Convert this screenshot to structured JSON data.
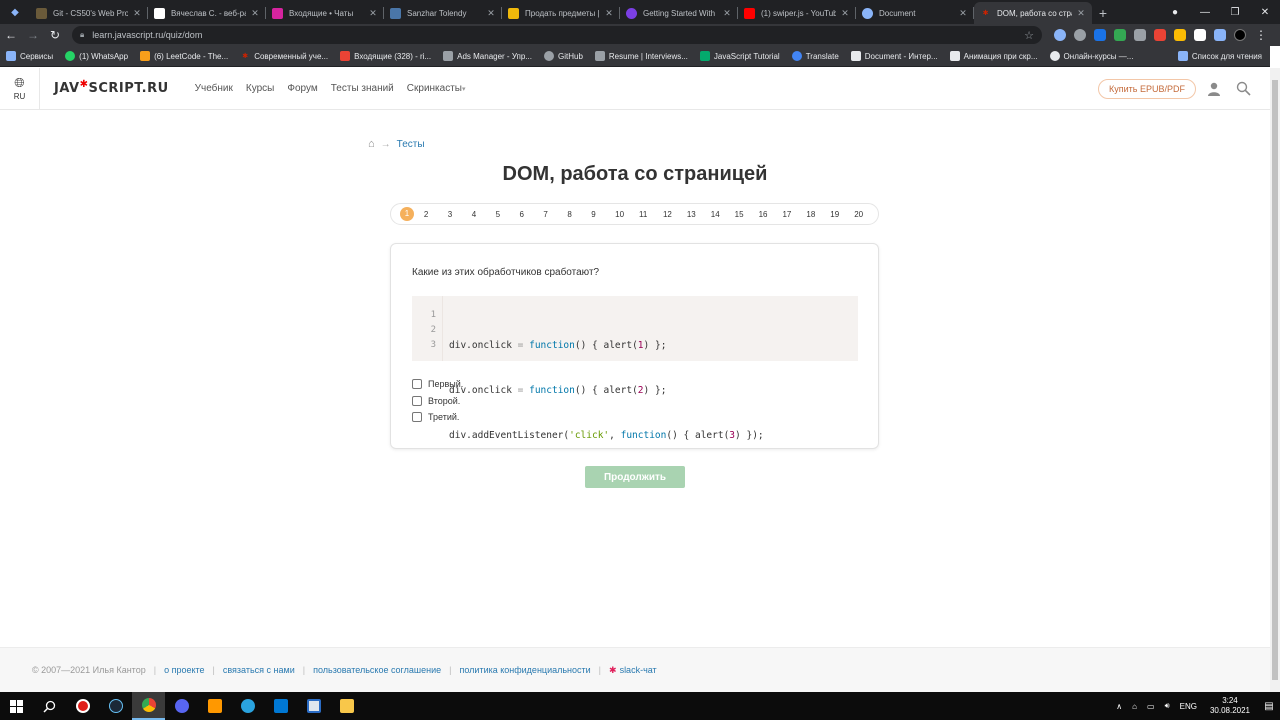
{
  "browser": {
    "tabs": [
      {
        "title": "Git - CS50's Web Prog",
        "color": "#6a5a3a"
      },
      {
        "title": "Вячеслав С. - веб-ра",
        "color": "#ffffff"
      },
      {
        "title": "Входящие • Чаты",
        "color": "#d6249f"
      },
      {
        "title": "Sanzhar Tolendy",
        "color": "#4a76a8"
      },
      {
        "title": "Продать предметы |",
        "color": "#f0b90b"
      },
      {
        "title": "Getting Started With",
        "color": "#7b3fe4"
      },
      {
        "title": "(1) swiper.js - YouTub",
        "color": "#ff0000"
      },
      {
        "title": "Document",
        "color": "#8ab4f8"
      },
      {
        "title": "DOM, работа со стра",
        "color": "#cc2200",
        "active": true
      }
    ],
    "url": "learn.javascript.ru/quiz/dom",
    "bookmarks": [
      {
        "label": "Сервисы",
        "color": "#8ab4f8"
      },
      {
        "label": "(1) WhatsApp",
        "color": "#25d366"
      },
      {
        "label": "(6) LeetCode - The...",
        "color": "#f89f1b"
      },
      {
        "label": "Современный уче...",
        "color": "#cc2200"
      },
      {
        "label": "Входящие (328) - ri...",
        "color": "#ea4335"
      },
      {
        "label": "Ads Manager - Упр...",
        "color": "#9aa0a6"
      },
      {
        "label": "GitHub",
        "color": "#9aa0a6"
      },
      {
        "label": "Resume | Interviews...",
        "color": "#9aa0a6"
      },
      {
        "label": "JavaScript Tutorial",
        "color": "#04aa6d"
      },
      {
        "label": "Translate",
        "color": "#4285f4"
      },
      {
        "label": "Document - Интер...",
        "color": "#e8eaed"
      },
      {
        "label": "Анимация при скр...",
        "color": "#e8eaed"
      },
      {
        "label": "Онлайн-курсы —...",
        "color": "#e8eaed"
      }
    ],
    "reading_list": "Список для чтения"
  },
  "header": {
    "lang_code": "RU",
    "logo_left": "JAV",
    "logo_star": "✱",
    "logo_right": "SCRIPT.RU",
    "nav": [
      "Учебник",
      "Курсы",
      "Форум",
      "Тесты знаний"
    ],
    "nav_dropdown": "Скринкасты",
    "buy_label": "Купить EPUB/PDF"
  },
  "breadcrumb": {
    "arrow": "→",
    "link": "Тесты"
  },
  "title": "DOM, работа со страницей",
  "pager": {
    "current": "1",
    "pages": [
      "2",
      "3",
      "4",
      "5",
      "6",
      "7",
      "8",
      "9",
      "10",
      "11",
      "12",
      "13",
      "14",
      "15",
      "16",
      "17",
      "18",
      "19",
      "20"
    ]
  },
  "quiz": {
    "question": "Какие из этих обработчиков сработают?",
    "line_numbers": [
      "1",
      "2",
      "3"
    ],
    "code": {
      "l1_a": "div.onclick ",
      "l1_eq": "=",
      "l1_fn": "function",
      "l1_b": "() { alert(",
      "l1_num": "1",
      "l1_c": ") };",
      "l2_a": "div.onclick ",
      "l2_eq": "=",
      "l2_fn": "function",
      "l2_b": "() { alert(",
      "l2_num": "2",
      "l2_c": ") };",
      "l3_a": "div.addEventListener(",
      "l3_str": "'click'",
      "l3_b": ", ",
      "l3_fn": "function",
      "l3_c": "() { alert(",
      "l3_num": "3",
      "l3_d": ") });"
    },
    "options": [
      "Первый.",
      "Второй.",
      "Третий."
    ],
    "continue_label": "Продолжить"
  },
  "footer": {
    "copyright": "© 2007—2021  Илья Кантор",
    "links": [
      "о проекте",
      "связаться с нами",
      "пользовательское соглашение",
      "политика конфиденциальности",
      "slack-чат"
    ]
  },
  "taskbar": {
    "lang": "ENG",
    "time": "3:24",
    "date": "30.08.2021"
  }
}
